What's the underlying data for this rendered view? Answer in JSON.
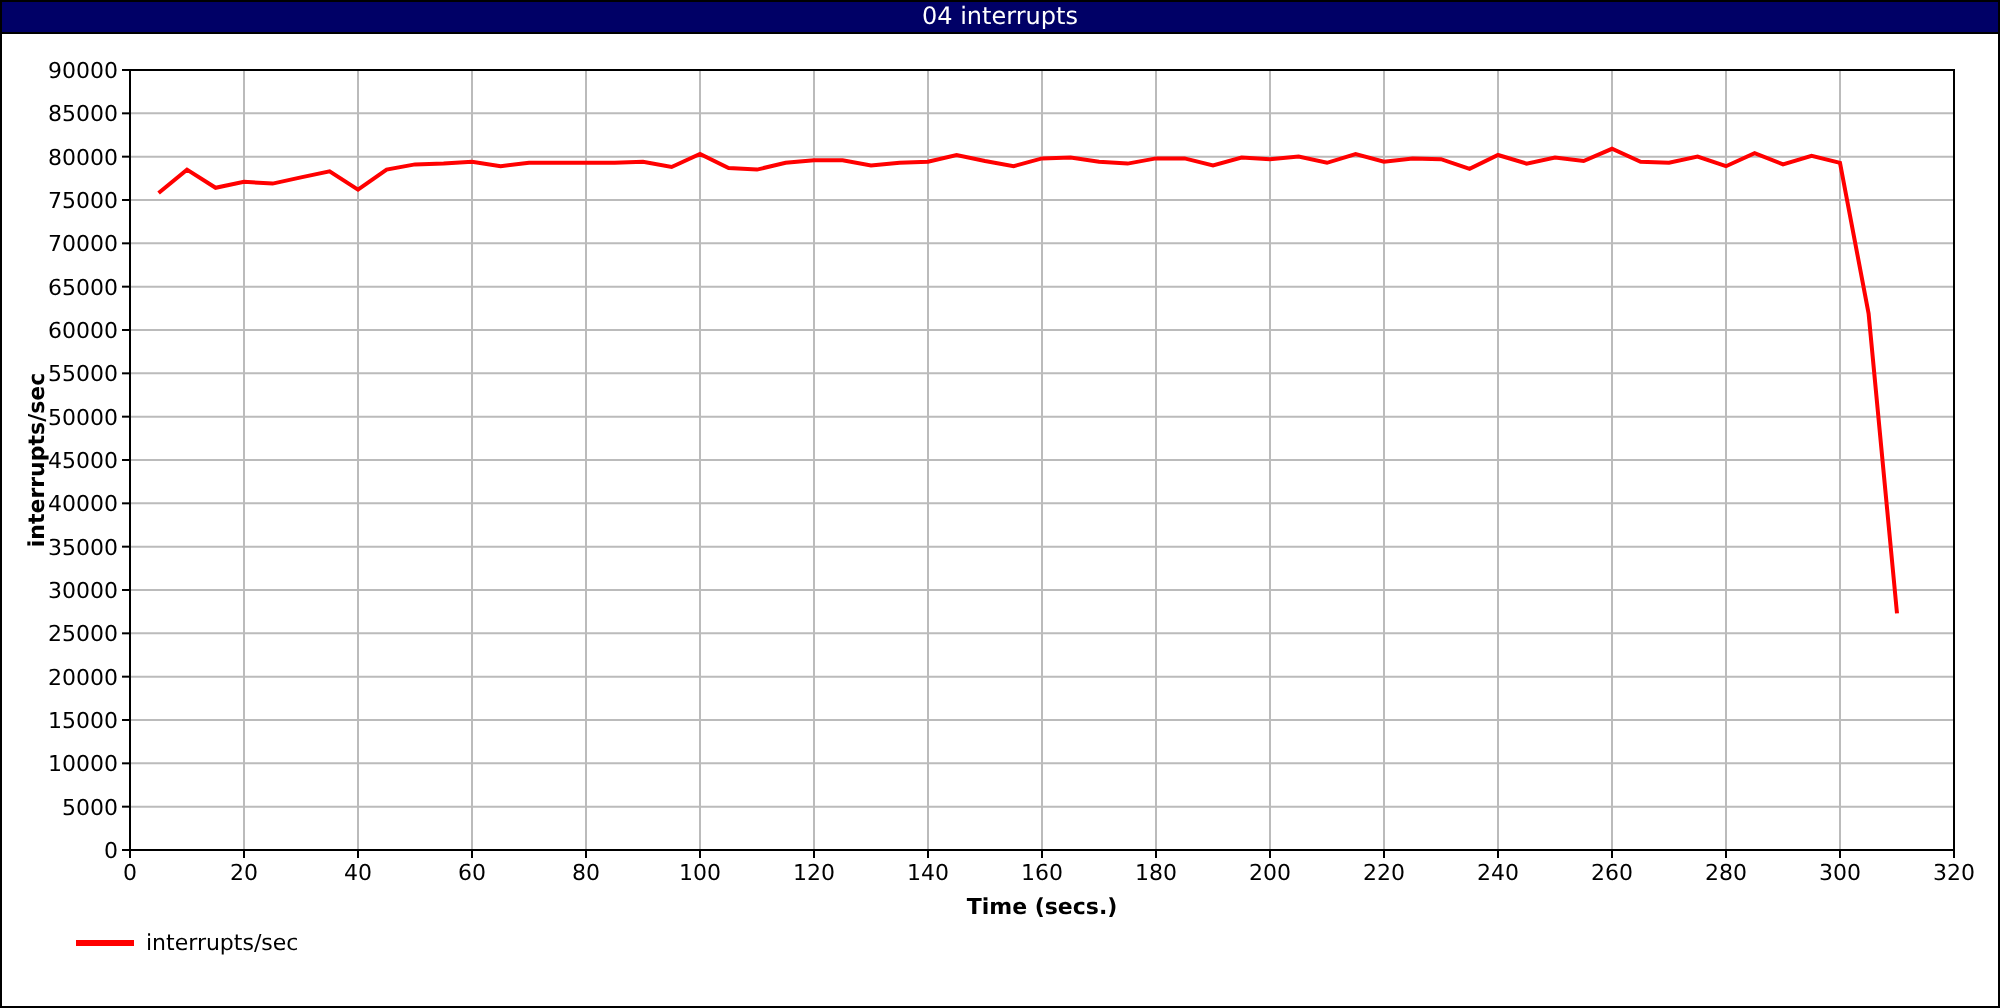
{
  "window": {
    "title": "04 interrupts"
  },
  "chart": {
    "chart_data": {
      "type": "line",
      "xlabel": "Time (secs.)",
      "ylabel": "interrupts/sec",
      "x": [
        5,
        10,
        15,
        20,
        25,
        30,
        35,
        40,
        45,
        50,
        55,
        60,
        65,
        70,
        75,
        80,
        85,
        90,
        95,
        100,
        105,
        110,
        115,
        120,
        125,
        130,
        135,
        140,
        145,
        150,
        155,
        160,
        165,
        170,
        175,
        180,
        185,
        190,
        195,
        200,
        205,
        210,
        215,
        220,
        225,
        230,
        235,
        240,
        245,
        250,
        255,
        260,
        265,
        270,
        275,
        280,
        285,
        290,
        295,
        300,
        305,
        310
      ],
      "series": [
        {
          "name": "interrupts/sec",
          "color": "#ff0000",
          "values": [
            75800,
            78500,
            76400,
            77100,
            76900,
            77600,
            78300,
            76200,
            78500,
            79100,
            79200,
            79400,
            78900,
            79300,
            79300,
            79300,
            79300,
            79400,
            78800,
            80300,
            78700,
            78500,
            79300,
            79600,
            79600,
            79000,
            79300,
            79400,
            80200,
            79500,
            78900,
            79800,
            79900,
            79400,
            79200,
            79800,
            79800,
            79000,
            79900,
            79700,
            80000,
            79300,
            80300,
            79400,
            79800,
            79700,
            78600,
            80200,
            79200,
            79900,
            79500,
            80900,
            79400,
            79300,
            80000,
            78900,
            80400,
            79100,
            80100,
            79300,
            61900,
            27300
          ]
        }
      ],
      "grid": true,
      "xlim": [
        0,
        320
      ],
      "ylim": [
        0,
        90000
      ],
      "xticks": [
        0,
        20,
        40,
        60,
        80,
        100,
        120,
        140,
        160,
        180,
        200,
        220,
        240,
        260,
        280,
        300,
        320
      ],
      "yticks": [
        0,
        5000,
        10000,
        15000,
        20000,
        25000,
        30000,
        35000,
        40000,
        45000,
        50000,
        55000,
        60000,
        65000,
        70000,
        75000,
        80000,
        85000,
        90000
      ]
    }
  }
}
